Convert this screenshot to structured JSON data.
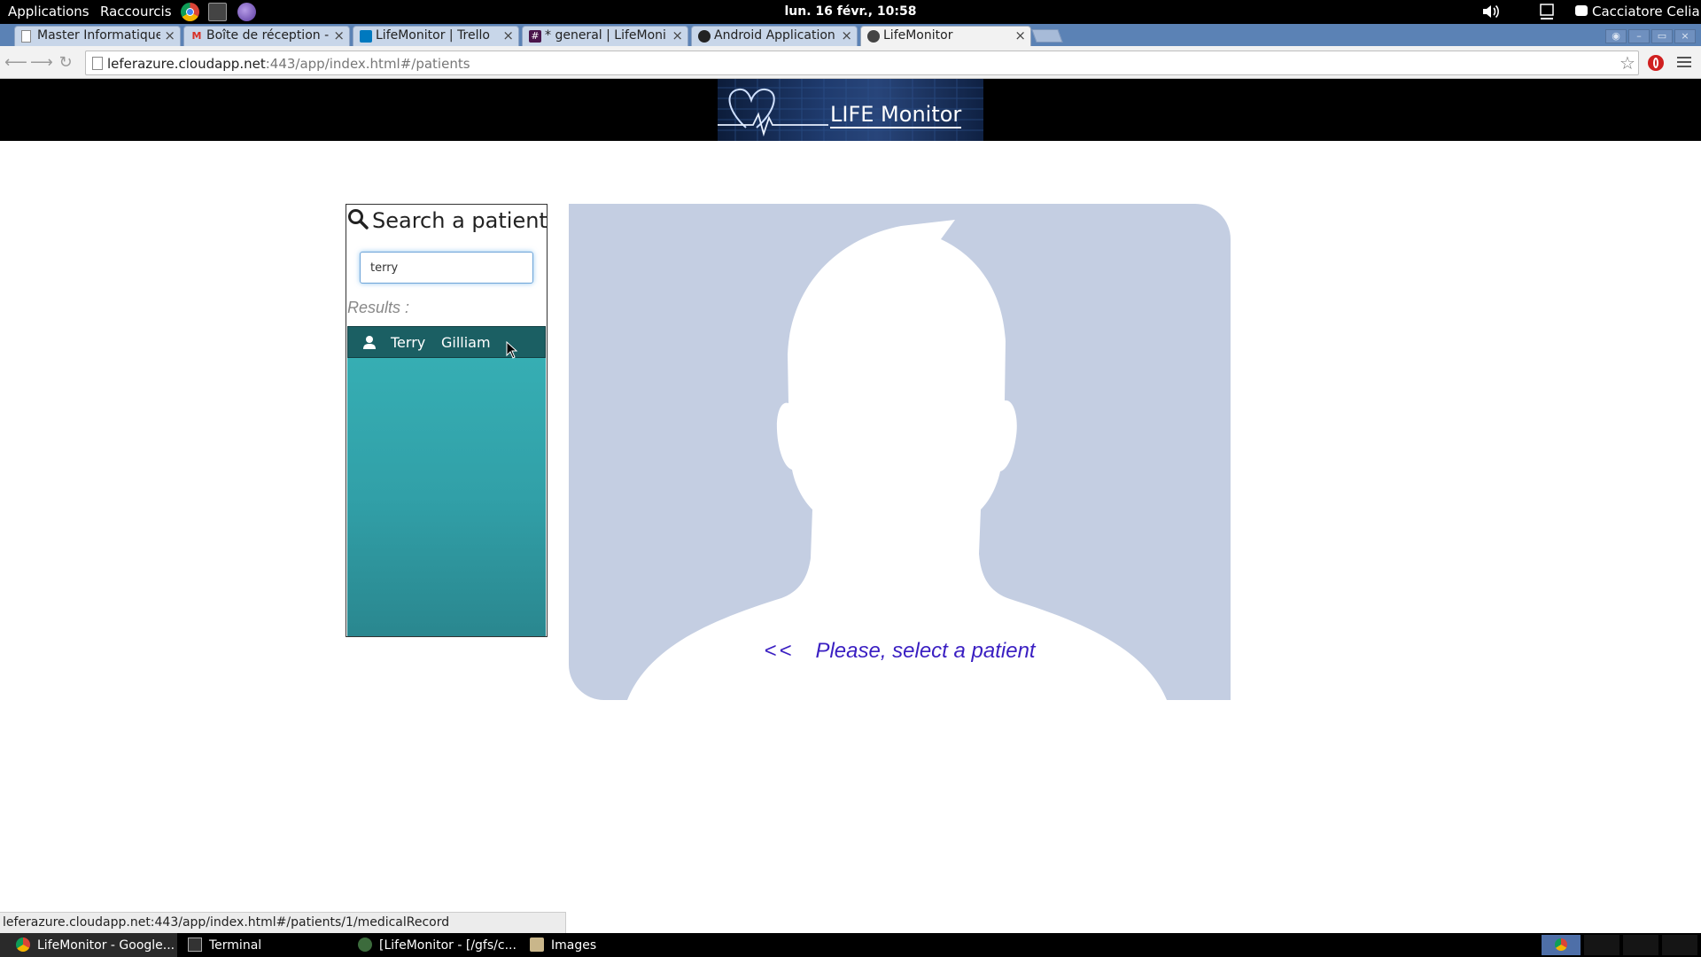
{
  "desktop": {
    "menus": {
      "applications": "Applications",
      "shortcuts": "Raccourcis"
    },
    "clock": "lun. 16 févr., 10:58",
    "user": "Cacciatore Celia"
  },
  "browser": {
    "tabs": [
      {
        "label": "Master Informatique",
        "icon": "page-icon"
      },
      {
        "label": "Boîte de réception -",
        "icon": "gmail-icon"
      },
      {
        "label": "LifeMonitor | Trello",
        "icon": "trello-icon"
      },
      {
        "label": "* general | LifeMoni",
        "icon": "slack-icon"
      },
      {
        "label": "Android Application",
        "icon": "github-icon"
      },
      {
        "label": "LifeMonitor",
        "icon": "lifemonitor-icon"
      }
    ],
    "url_host": "leferazure.cloudapp.net",
    "url_rest": ":443/app/index.html#/patients",
    "status_url": "leferazure.cloudapp.net:443/app/index.html#/patients/1/medicalRecord"
  },
  "app": {
    "logo_text": "LIFE Monitor",
    "search": {
      "title": "Search a patient",
      "query": "terry",
      "results_label": "Results :",
      "results": [
        {
          "first_name": "Terry",
          "last_name": "Gilliam"
        }
      ]
    },
    "placeholder": {
      "arrows": "<<",
      "message": "Please, select a patient"
    },
    "colors": {
      "header_bg": "#000000",
      "results_bg": "#31a0a8",
      "selected_result_bg": "#1b5f63",
      "placeholder_bg": "#c4cee2",
      "prompt_color": "#3a1fc2"
    }
  },
  "taskbar": {
    "items": [
      {
        "label": "LifeMonitor - Google...",
        "icon": "chrome-icon"
      },
      {
        "label": "Terminal",
        "icon": "terminal-icon"
      },
      {
        "label": "[LifeMonitor - [/gfs/c...",
        "icon": "eclipse-icon"
      },
      {
        "label": "Images",
        "icon": "folder-icon"
      }
    ]
  }
}
